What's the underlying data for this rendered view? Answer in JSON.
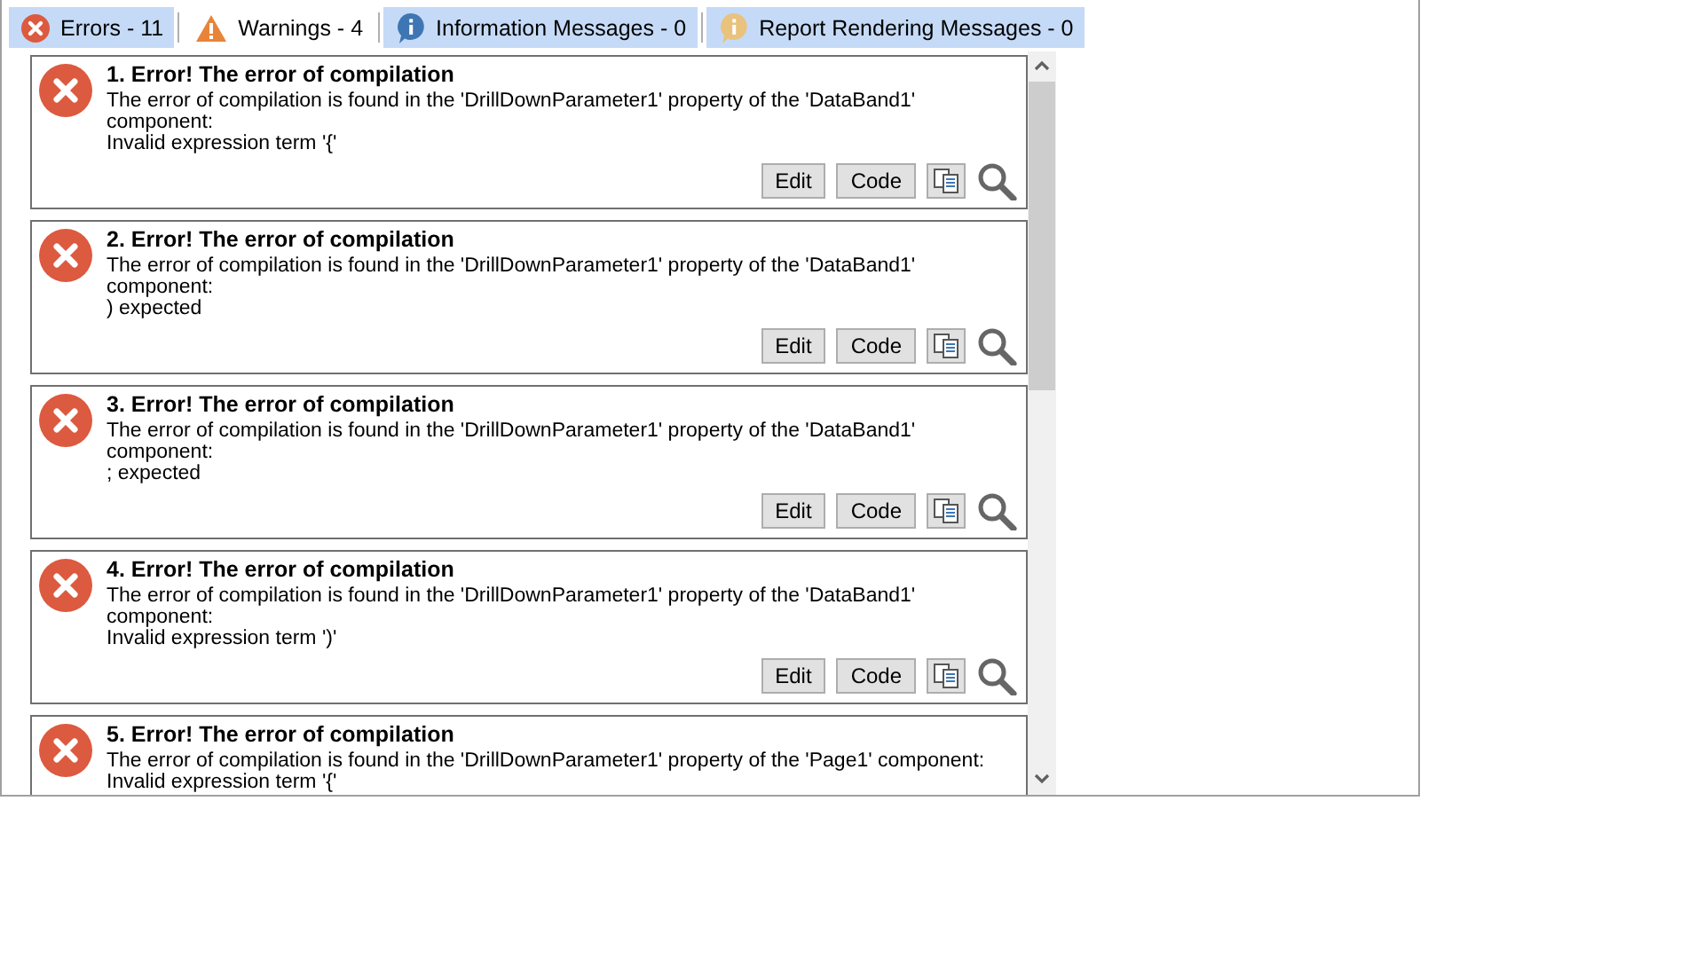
{
  "tabs": [
    {
      "kind": "error",
      "label": "Errors - 11",
      "selected": true
    },
    {
      "kind": "warning",
      "label": "Warnings - 4",
      "selected": false
    },
    {
      "kind": "info",
      "label": "Information Messages - 0",
      "selected": true
    },
    {
      "kind": "rendering",
      "label": "Report Rendering Messages - 0",
      "selected": true
    }
  ],
  "messages": [
    {
      "title": "1. Error! The error of compilation",
      "text": "The error of compilation is found in the 'DrillDownParameter1' property of the 'DataBand1' component:",
      "detail": "Invalid expression term '{'",
      "buttons": [
        "Edit",
        "Code"
      ]
    },
    {
      "title": "2. Error! The error of compilation",
      "text": "The error of compilation is found in the 'DrillDownParameter1' property of the 'DataBand1' component:",
      "detail": ") expected",
      "buttons": [
        "Edit",
        "Code"
      ]
    },
    {
      "title": "3. Error! The error of compilation",
      "text": "The error of compilation is found in the 'DrillDownParameter1' property of the 'DataBand1' component:",
      "detail": "; expected",
      "buttons": [
        "Edit",
        "Code"
      ]
    },
    {
      "title": "4. Error! The error of compilation",
      "text": "The error of compilation is found in the 'DrillDownParameter1' property of the 'DataBand1' component:",
      "detail": "Invalid expression term ')'",
      "buttons": [
        "Edit",
        "Code"
      ]
    },
    {
      "title": "5. Error! The error of compilation",
      "text": "The error of compilation is found in the 'DrillDownParameter1' property of the 'Page1' component:",
      "detail": "Invalid expression term '{'"
    }
  ]
}
